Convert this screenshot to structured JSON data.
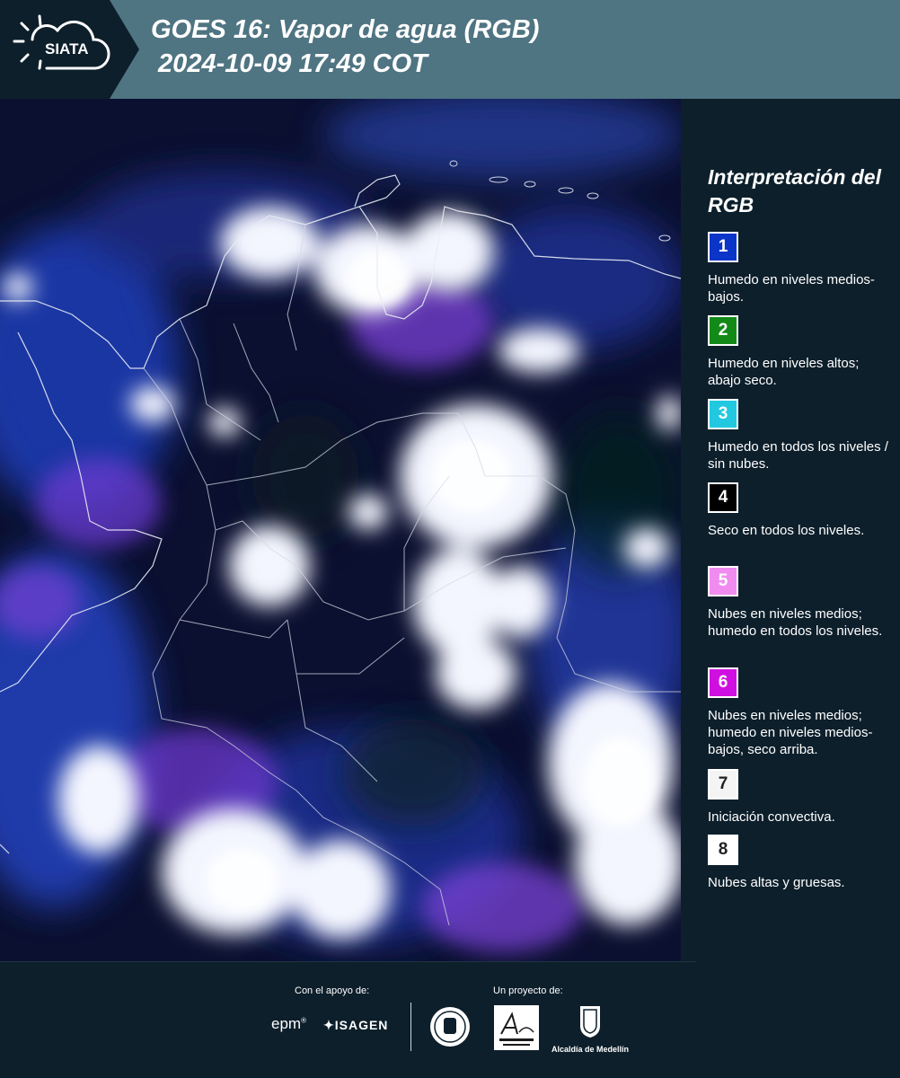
{
  "header": {
    "logo_text": "SIATA",
    "title_line1": "GOES 16: Vapor de agua (RGB)",
    "title_line2": " 2024-10-09 17:49 COT"
  },
  "legend": {
    "title": "Interpretación del RGB",
    "items": [
      {
        "number": "1",
        "color": "#0a35c8",
        "text": "Humedo en niveles medios-bajos."
      },
      {
        "number": "2",
        "color": "#138a18",
        "text": "Humedo en niveles altos; abajo seco."
      },
      {
        "number": "3",
        "color": "#22c8e0",
        "text": "Humedo en todos los niveles / sin nubes."
      },
      {
        "number": "4",
        "color": "#000000",
        "text": "Seco en todos los niveles."
      },
      {
        "number": "5",
        "color": "#f08cf0",
        "text": "Nubes en niveles medios; humedo en todos los niveles."
      },
      {
        "number": "6",
        "color": "#d010e0",
        "text": "Nubes en niveles medios; humedo en niveles medios-bajos, seco arriba."
      },
      {
        "number": "7",
        "color": "#f4f4f4",
        "text": "Iniciación convectiva."
      },
      {
        "number": "8",
        "color": "#ffffff",
        "text": "Nubes altas y gruesas."
      }
    ]
  },
  "footer": {
    "support_label": "Con el apoyo de:",
    "project_label": "Un proyecto de:",
    "sponsors": [
      "epm",
      "ISAGEN"
    ],
    "partners": [
      "Área Metropolitana Valle de Aburrá",
      "Alcaldía de Medellín"
    ],
    "alcaldia_label": "Alcaldía de Medellín"
  },
  "colors": {
    "header_bg": "#4f7482",
    "panel_bg": "#0d1f2b"
  }
}
